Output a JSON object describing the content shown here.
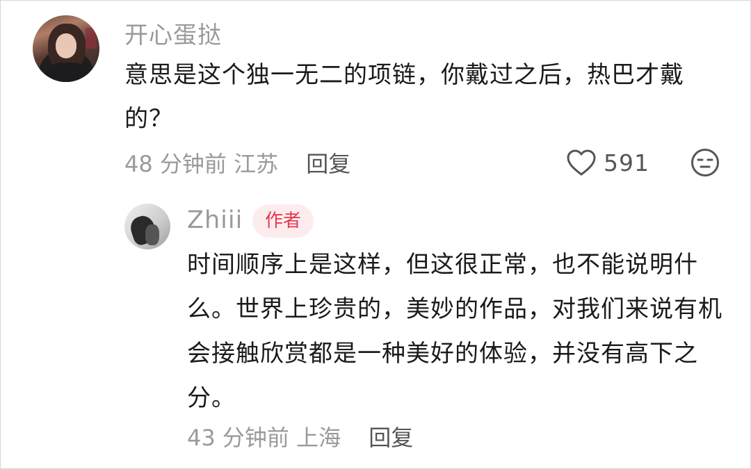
{
  "main_comment": {
    "username": "开心蛋挞",
    "text": "意思是这个独一无二的项链，你戴过之后，热巴才戴的？",
    "time": "48 分钟前",
    "location": "江苏",
    "reply_label": "回复",
    "like_count": "591"
  },
  "reply_comment": {
    "username": "Zhiii",
    "badge": "作者",
    "text": "时间顺序上是这样，但这很正常，也不能说明什么。世界上珍贵的，美妙的作品，对我们来说有机会接触欣赏都是一种美好的体验，并没有高下之分。",
    "time": "43 分钟前",
    "location": "上海",
    "reply_label": "回复"
  },
  "colors": {
    "badge_text": "#e4394f",
    "badge_bg": "#fdecee",
    "meta_text": "#9a9a9a"
  },
  "icons": {
    "like": "heart-outline-icon",
    "react": "neutral-face-icon"
  }
}
